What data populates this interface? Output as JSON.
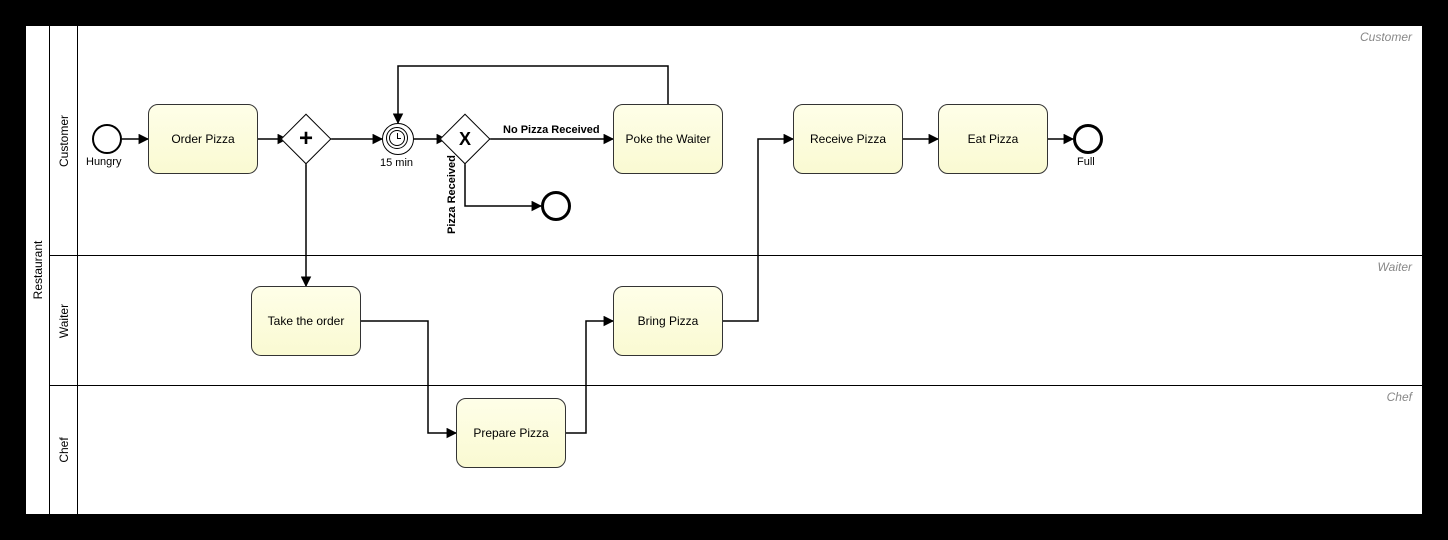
{
  "pool": {
    "name": "Restaurant"
  },
  "lanes": [
    {
      "id": "customer",
      "name": "Customer",
      "nameEcho": "Customer"
    },
    {
      "id": "waiter",
      "name": "Waiter",
      "nameEcho": "Waiter"
    },
    {
      "id": "chef",
      "name": "Chef",
      "nameEcho": "Chef"
    }
  ],
  "events": {
    "start": {
      "label": "Hungry"
    },
    "timer": {
      "label": "15 min"
    },
    "intermediateEnd": {
      "label": ""
    },
    "end": {
      "label": "Full"
    }
  },
  "gateways": {
    "parallel": {
      "marker": "+"
    },
    "exclusive": {
      "marker": "X"
    }
  },
  "tasks": {
    "orderPizza": "Order Pizza",
    "pokeWaiter": "Poke the Waiter",
    "receivePizza": "Receive Pizza",
    "eatPizza": "Eat Pizza",
    "takeOrder": "Take the order",
    "bringPizza": "Bring Pizza",
    "preparePizza": "Prepare Pizza"
  },
  "flowLabels": {
    "noPizza": "No Pizza Received",
    "pizzaReceived": "Pizza Received"
  }
}
